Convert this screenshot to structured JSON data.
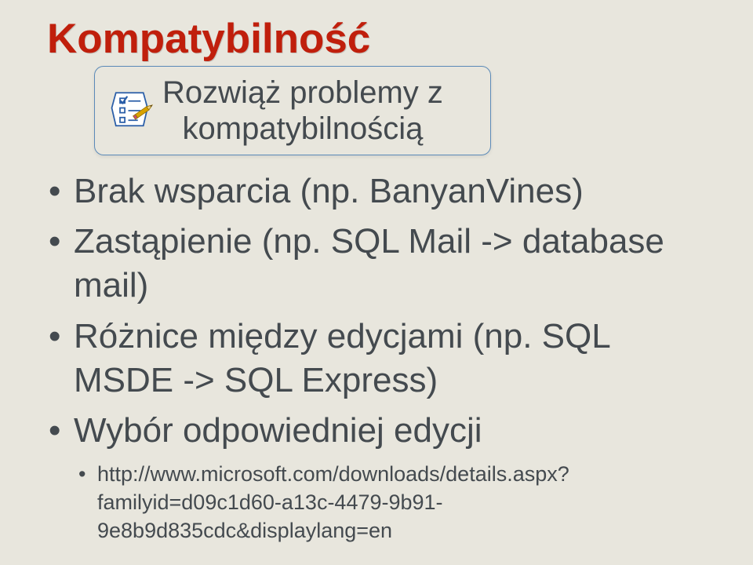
{
  "title": "Kompatybilność",
  "callout": {
    "line1": "Rozwiąż problemy z",
    "line2": "kompatybilnością",
    "icon_name": "checklist-icon"
  },
  "bullets": [
    {
      "text": "Brak wsparcia (np. BanyanVines)"
    },
    {
      "text": "Zastąpienie (np. SQL Mail -> database mail)"
    },
    {
      "text": "Różnice między edycjami (np. SQL MSDE -> SQL Express)"
    },
    {
      "text": "Wybór odpowiedniej edycji",
      "sub": [
        "http://www.microsoft.com/downloads/details.aspx?familyid=d09c1d60-a13c-4479-9b91-9e8b9d835cdc&displaylang=en"
      ]
    }
  ],
  "colors": {
    "title": "#c01f0c",
    "body": "#444a4f",
    "callout_border": "#5b8ab8",
    "background": "#e8e6dd"
  }
}
